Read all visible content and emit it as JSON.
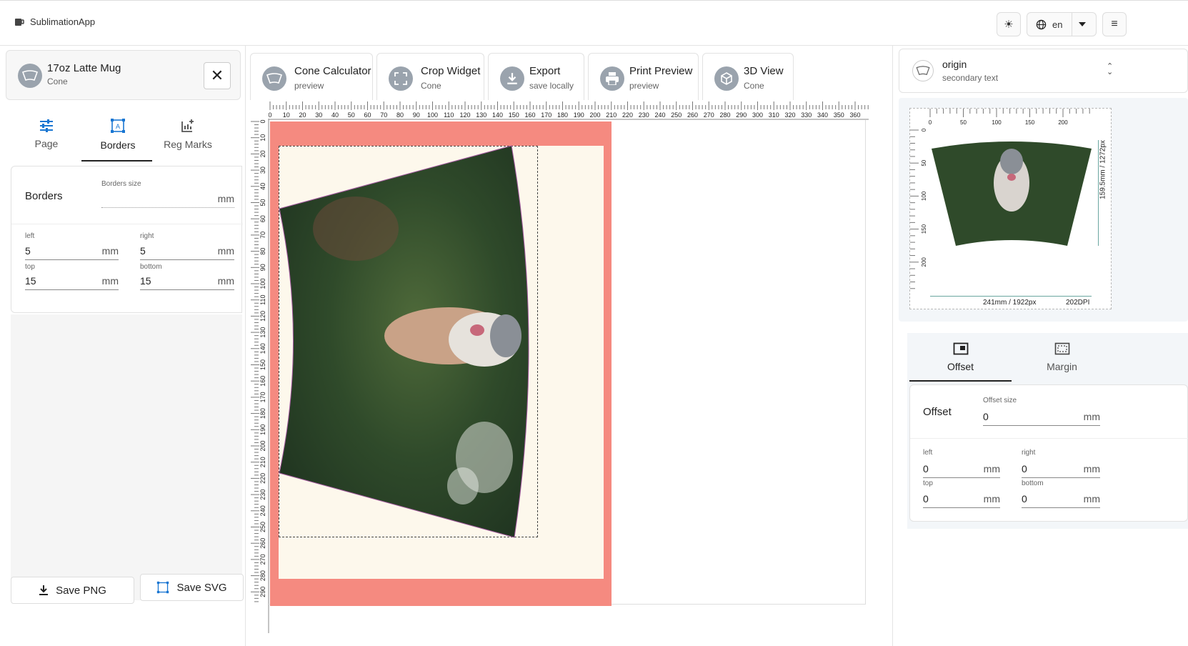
{
  "app": {
    "title": "SublimationApp",
    "language": "en"
  },
  "product": {
    "name": "17oz Latte Mug",
    "shape": "Cone"
  },
  "left_tabs": [
    {
      "label": "Page",
      "icon": "sliders-icon"
    },
    {
      "label": "Borders",
      "icon": "borders-icon"
    },
    {
      "label": "Reg Marks",
      "icon": "reg-marks-icon"
    }
  ],
  "borders": {
    "heading": "Borders",
    "size_label": "Borders size",
    "size_value": "",
    "unit": "mm",
    "left_label": "left",
    "left": "5",
    "right_label": "right",
    "right": "5",
    "top_label": "top",
    "top": "15",
    "bottom_label": "bottom",
    "bottom": "15"
  },
  "save": {
    "png": "Save PNG",
    "svg": "Save SVG"
  },
  "tools": [
    {
      "title": "Cone Calculator",
      "subtitle": "preview",
      "icon": "cone-icon"
    },
    {
      "title": "Crop Widget",
      "subtitle": "Cone",
      "icon": "crop-icon"
    },
    {
      "title": "Export",
      "subtitle": "save locally",
      "icon": "download-icon"
    },
    {
      "title": "Print Preview",
      "subtitle": "preview",
      "icon": "printer-icon"
    },
    {
      "title": "3D View",
      "subtitle": "Cone",
      "icon": "cube-icon"
    }
  ],
  "ruler": {
    "h_labels": [
      "0",
      "10",
      "20",
      "30",
      "40",
      "50",
      "60",
      "70",
      "80",
      "90",
      "100",
      "110",
      "120",
      "130",
      "140",
      "150",
      "160",
      "170",
      "180",
      "190",
      "200",
      "210",
      "220",
      "230",
      "240",
      "250",
      "260",
      "270",
      "280",
      "290",
      "300",
      "310",
      "320",
      "330",
      "340",
      "350",
      "360"
    ],
    "v_labels": [
      "0",
      "10",
      "20",
      "30",
      "40",
      "50",
      "60",
      "70",
      "80",
      "90",
      "100",
      "110",
      "120",
      "130",
      "140",
      "150",
      "160",
      "170",
      "180",
      "190",
      "200",
      "210",
      "220",
      "230",
      "240",
      "250",
      "260",
      "270",
      "280",
      "290"
    ]
  },
  "origin": {
    "title": "origin",
    "subtitle": "secondary text"
  },
  "preview": {
    "h_labels": [
      "0",
      "50",
      "100",
      "150",
      "200"
    ],
    "v_labels": [
      "0",
      "50",
      "100",
      "150",
      "200"
    ],
    "width_text": "241mm / 1922px",
    "height_text": "159.5mm / 1272px",
    "dpi_text": "202DPI"
  },
  "right_tabs": [
    {
      "label": "Offset",
      "icon": "offset-icon"
    },
    {
      "label": "Margin",
      "icon": "margin-icon"
    }
  ],
  "offset": {
    "heading": "Offset",
    "size_label": "Offset size",
    "size_value": "0",
    "unit": "mm",
    "left_label": "left",
    "left": "0",
    "right_label": "right",
    "right": "0",
    "top_label": "top",
    "top": "0",
    "bottom_label": "bottom",
    "bottom": "0"
  },
  "colors": {
    "sheet_bleed": "#f58a80",
    "sheet_paper": "#fdf8ec",
    "accent": "#1976d2"
  }
}
